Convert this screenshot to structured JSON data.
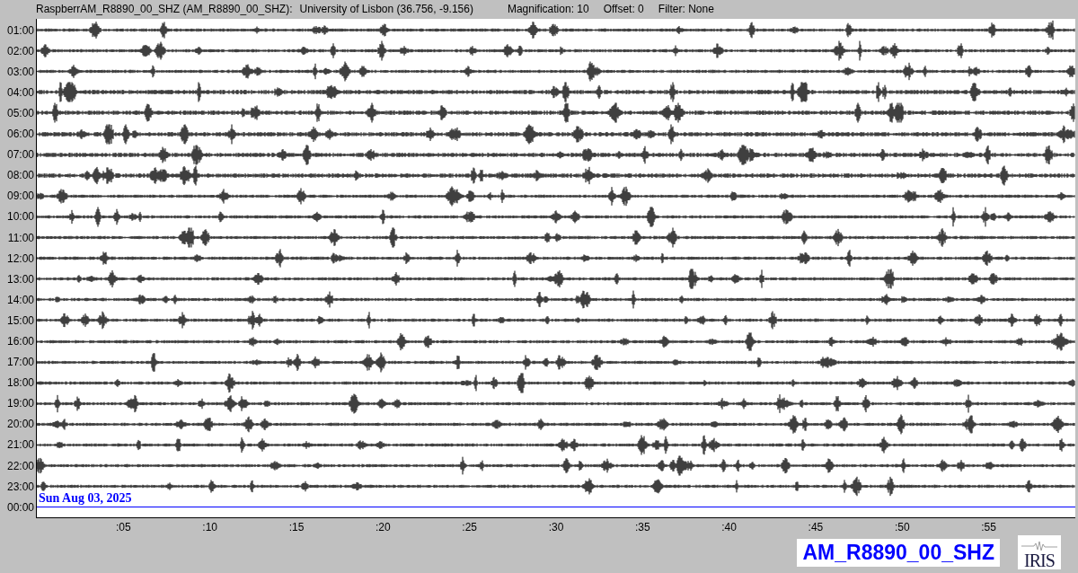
{
  "header": {
    "station": "RaspberrAM_R8890_00_SHZ (AM_R8890_00_SHZ):",
    "location": "University of Lisbon (36.756, -9.156)",
    "magnification": "Magnification: 10",
    "offset": "Offset: 0",
    "filter": "Filter: None"
  },
  "rows": [
    {
      "time": "01:00",
      "kind": "trace"
    },
    {
      "time": "02:00",
      "kind": "trace"
    },
    {
      "time": "03:00",
      "kind": "trace"
    },
    {
      "time": "04:00",
      "kind": "trace"
    },
    {
      "time": "05:00",
      "kind": "trace"
    },
    {
      "time": "06:00",
      "kind": "trace"
    },
    {
      "time": "07:00",
      "kind": "trace"
    },
    {
      "time": "08:00",
      "kind": "trace"
    },
    {
      "time": "09:00",
      "kind": "trace"
    },
    {
      "time": "10:00",
      "kind": "trace"
    },
    {
      "time": "11:00",
      "kind": "trace"
    },
    {
      "time": "12:00",
      "kind": "trace"
    },
    {
      "time": "13:00",
      "kind": "trace"
    },
    {
      "time": "14:00",
      "kind": "trace"
    },
    {
      "time": "15:00",
      "kind": "trace"
    },
    {
      "time": "16:00",
      "kind": "trace"
    },
    {
      "time": "17:00",
      "kind": "trace"
    },
    {
      "time": "18:00",
      "kind": "trace"
    },
    {
      "time": "19:00",
      "kind": "trace"
    },
    {
      "time": "20:00",
      "kind": "trace"
    },
    {
      "time": "21:00",
      "kind": "trace"
    },
    {
      "time": "22:00",
      "kind": "trace"
    },
    {
      "time": "23:00",
      "kind": "trace"
    },
    {
      "time": "00:00",
      "kind": "current",
      "date": "Sun Aug 03, 2025"
    }
  ],
  "x_axis": [
    ":05",
    ":10",
    ":15",
    ":20",
    ":25",
    ":30",
    ":35",
    ":40",
    ":45",
    ":50",
    ":55"
  ],
  "station_label": "AM_R8890_00_SHZ",
  "logo": "IRIS"
}
